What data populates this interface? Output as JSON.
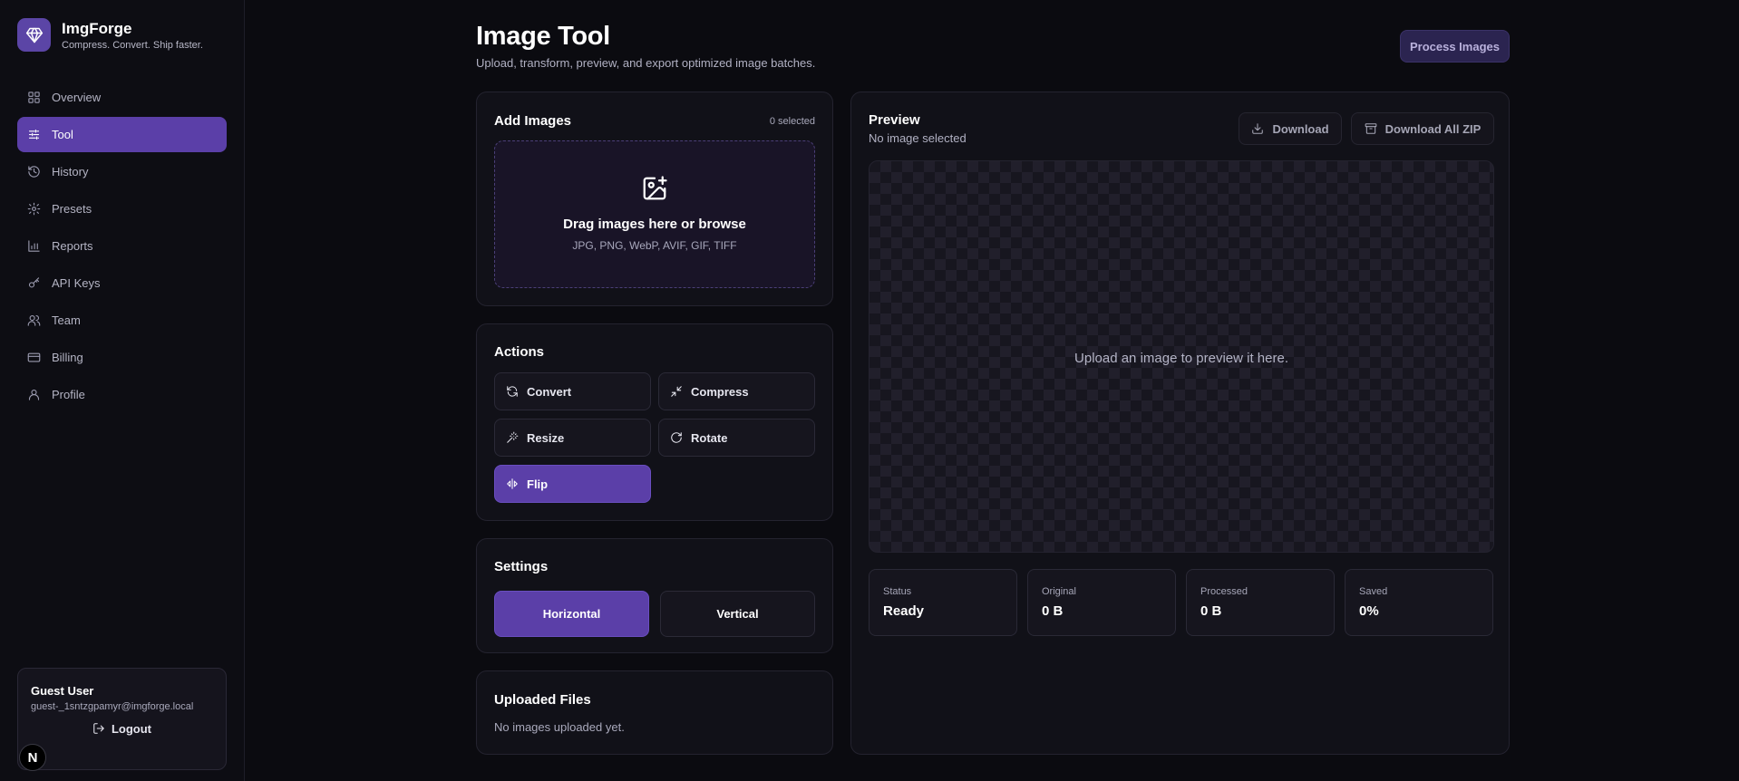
{
  "app": {
    "name": "ImgForge",
    "tagline": "Compress. Convert. Ship faster."
  },
  "sidebar": {
    "items": [
      {
        "label": "Overview",
        "icon": "grid-icon"
      },
      {
        "label": "Tool",
        "icon": "sliders-icon",
        "active": true
      },
      {
        "label": "History",
        "icon": "history-icon"
      },
      {
        "label": "Presets",
        "icon": "gear-icon"
      },
      {
        "label": "Reports",
        "icon": "bar-chart-icon"
      },
      {
        "label": "API Keys",
        "icon": "key-icon"
      },
      {
        "label": "Team",
        "icon": "users-icon"
      },
      {
        "label": "Billing",
        "icon": "credit-card-icon"
      },
      {
        "label": "Profile",
        "icon": "user-icon"
      }
    ]
  },
  "user": {
    "name": "Guest User",
    "email": "guest-_1sntzgpamyr@imgforge.local",
    "logout_label": "Logout"
  },
  "framework_badge": "N",
  "header": {
    "title": "Image Tool",
    "subtitle": "Upload, transform, preview, and export optimized image batches.",
    "process_label": "Process Images"
  },
  "add_images": {
    "title": "Add Images",
    "selected_count": "0 selected",
    "drop_title": "Drag images here or browse",
    "drop_formats": "JPG, PNG, WebP, AVIF, GIF, TIFF"
  },
  "actions": {
    "title": "Actions",
    "buttons": [
      {
        "label": "Convert",
        "icon": "refresh-icon"
      },
      {
        "label": "Compress",
        "icon": "minimize-icon"
      },
      {
        "label": "Resize",
        "icon": "wand-icon"
      },
      {
        "label": "Rotate",
        "icon": "rotate-icon"
      },
      {
        "label": "Flip",
        "icon": "flip-icon",
        "active": true
      }
    ]
  },
  "settings": {
    "title": "Settings",
    "options": [
      {
        "label": "Horizontal",
        "selected": true
      },
      {
        "label": "Vertical",
        "selected": false
      }
    ]
  },
  "uploaded": {
    "title": "Uploaded Files",
    "empty_text": "No images uploaded yet."
  },
  "preview": {
    "title": "Preview",
    "subtitle": "No image selected",
    "download_label": "Download",
    "download_zip_label": "Download All ZIP",
    "empty_message": "Upload an image to preview it here.",
    "stats": [
      {
        "label": "Status",
        "value": "Ready"
      },
      {
        "label": "Original",
        "value": "0 B"
      },
      {
        "label": "Processed",
        "value": "0 B"
      },
      {
        "label": "Saved",
        "value": "0%"
      }
    ]
  },
  "colors": {
    "accent": "#5b3fa8",
    "background": "#0b0b10",
    "card": "#111118"
  }
}
